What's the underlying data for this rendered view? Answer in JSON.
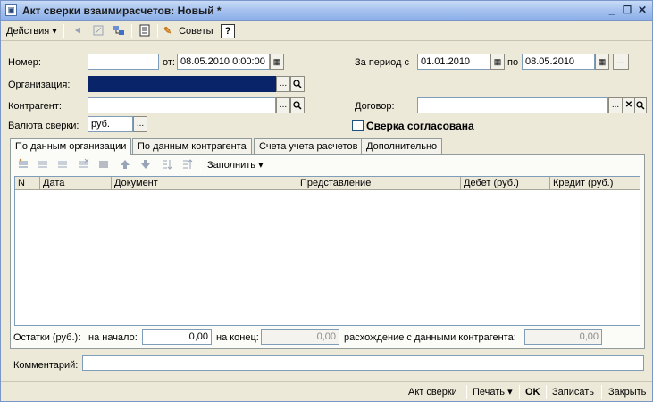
{
  "window": {
    "title": "Акт сверки взаимирасчетов: Новый *",
    "title_icon": "▣",
    "minimize_icon": "_",
    "maximize_icon": "☐",
    "close_icon": "✕"
  },
  "toolbar": {
    "actions_label": "Действия",
    "advice_label": "Советы",
    "help_label": "?",
    "dropdown_arrow": "▾"
  },
  "form": {
    "number_label": "Номер:",
    "number_value": "",
    "from_label": "от:",
    "date_value": "08.05.2010  0:00:00",
    "period_label": "За период с",
    "period_start": "01.01.2010",
    "period_to_label": "по",
    "period_end": "08.05.2010",
    "organization_label": "Организация:",
    "organization_value": "",
    "counterparty_label": "Контрагент:",
    "counterparty_value": "",
    "contract_label": "Договор:",
    "contract_value": "",
    "currency_label": "Валюта сверки:",
    "currency_value": "руб.",
    "agreed_label": "Сверка согласована",
    "agreed_checked": false,
    "ellipsis": "...",
    "clear_icon": "✕",
    "search_icon": "🔍"
  },
  "tabs": [
    {
      "label": "По данным организации"
    },
    {
      "label": "По данным контрагента"
    },
    {
      "label": "Счета учета расчетов"
    },
    {
      "label": "Дополнительно"
    }
  ],
  "grid_toolbar": {
    "fill_label": "Заполнить"
  },
  "grid": {
    "columns": [
      "N",
      "Дата",
      "Документ",
      "Представление",
      "Дебет (руб.)",
      "Кредит (руб.)"
    ]
  },
  "balances": {
    "label": "Остатки (руб.):",
    "start_label": "на начало:",
    "start_value": "0,00",
    "end_label": "на конец:",
    "end_value": "0,00",
    "diff_label": "расхождение с данными контрагента:",
    "diff_value": "0,00"
  },
  "comment": {
    "label": "Комментарий:",
    "value": ""
  },
  "footer": {
    "act_label": "Акт сверки",
    "print_label": "Печать",
    "ok_label": "OK",
    "save_label": "Записать",
    "close_label": "Закрыть"
  },
  "colors": {
    "title_gradient_start": "#c9dcf7",
    "title_gradient_end": "#8cb0ea",
    "selected_field": "#0a246a",
    "window_bg": "#ece9d8"
  }
}
